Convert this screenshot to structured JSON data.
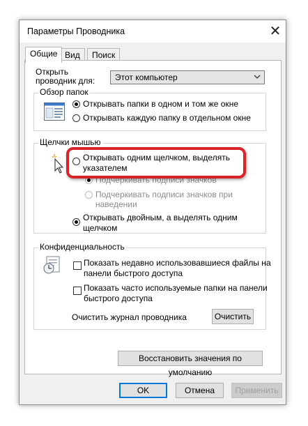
{
  "window": {
    "title": "Параметры Проводника",
    "close_glyph": "✕"
  },
  "tabs": [
    {
      "label": "Общие",
      "active": true
    },
    {
      "label": "Вид",
      "active": false
    },
    {
      "label": "Поиск",
      "active": false
    }
  ],
  "open_explorer": {
    "label": "Открыть проводник для:",
    "value": "Этот компьютер"
  },
  "browse_folders": {
    "legend": "Обзор папок",
    "icon": "folder-window-icon",
    "options": [
      {
        "label": "Открывать папки в одном и том же окне",
        "checked": true
      },
      {
        "label": "Открывать каждую папку в отдельном окне",
        "checked": false
      }
    ]
  },
  "mouse_clicks": {
    "legend": "Щелчки мышью",
    "icon": "mouse-pointer-icon",
    "single_click": {
      "line1": "Открывать одним щелчком, выделять",
      "line2": "указателем",
      "checked": false
    },
    "underline_always": {
      "label": "Подчеркивать подписи значков",
      "checked": true,
      "disabled": true
    },
    "underline_hover": {
      "line1": "Подчеркивать подписи значков при",
      "line2": "наведении",
      "checked": false,
      "disabled": true
    },
    "double_click": {
      "line1": "Открывать двойным, а выделять одним",
      "line2": "щелчком",
      "checked": true
    }
  },
  "privacy": {
    "legend": "Конфиденциальность",
    "icon": "privacy-icon",
    "recent_files": {
      "line1": "Показать недавно использовавшиеся файлы на",
      "line2": "панели быстрого доступа",
      "checked": false
    },
    "frequent_folders": {
      "line1": "Показать часто используемые папки на панели",
      "line2": "быстрого доступа",
      "checked": false
    },
    "clear_label": "Очистить журнал проводника",
    "clear_button": "Очистить"
  },
  "restore_defaults": "Восстановить значения по умолчанию",
  "buttons": {
    "ok": "OK",
    "cancel": "Отмена",
    "apply": "Применить"
  },
  "colors": {
    "highlight": "#d8232a",
    "focus": "#0078d7"
  }
}
